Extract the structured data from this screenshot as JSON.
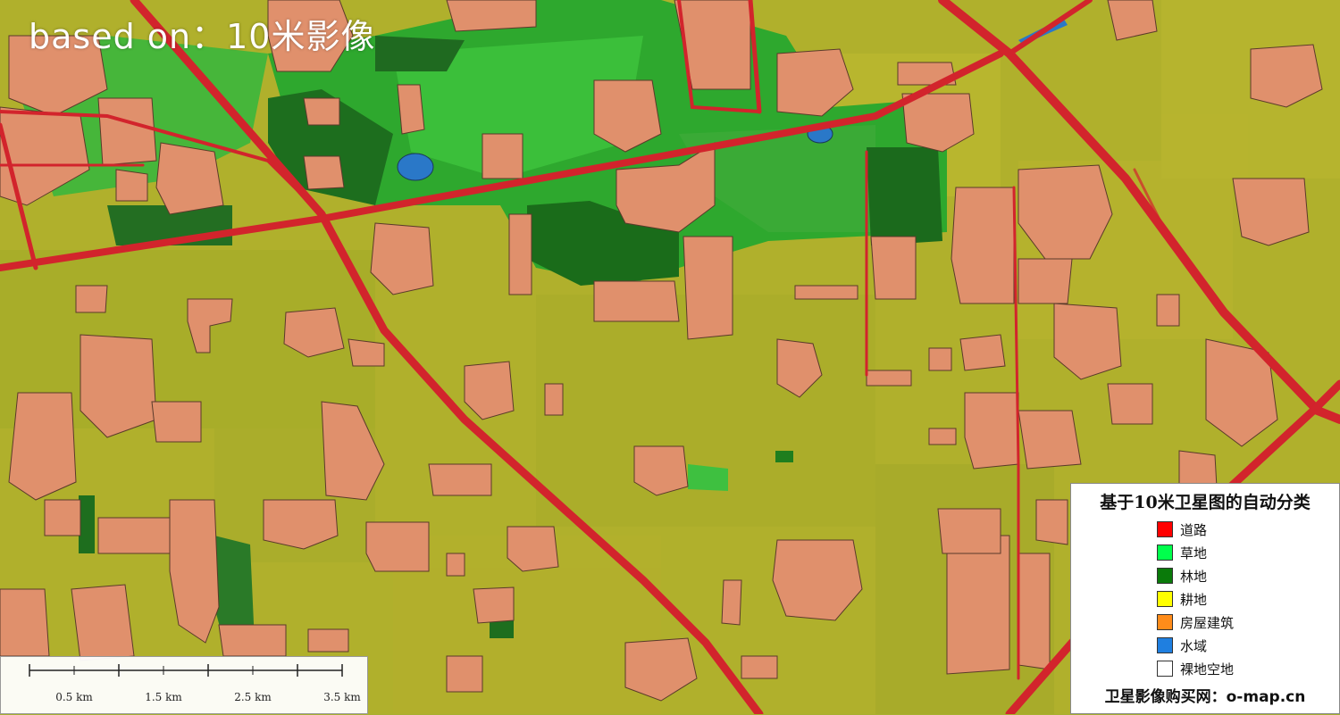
{
  "map": {
    "overlay_title": "based on：10米影像",
    "background_colors": {
      "cropland": "#b4b22a",
      "road": "#d2242c",
      "grass": "#3db530",
      "forest": "#1f7a22",
      "building": "#e1916a",
      "water": "#2a78c8"
    }
  },
  "legend": {
    "title": "基于10米卫星图的自动分类",
    "items": [
      {
        "label": "道路",
        "color": "#ff0000"
      },
      {
        "label": "草地",
        "color": "#00ff4c"
      },
      {
        "label": "林地",
        "color": "#0a7a0a"
      },
      {
        "label": "耕地",
        "color": "#ffff00"
      },
      {
        "label": "房屋建筑",
        "color": "#ff8c1a"
      },
      {
        "label": "水域",
        "color": "#1f7fe0"
      },
      {
        "label": "裸地空地",
        "color": "#ffffff"
      }
    ],
    "footer": "卫星影像购买网：o-map.cn"
  },
  "scalebar": {
    "labels": [
      "0.5 km",
      "1.5 km",
      "2.5 km",
      "3.5 km"
    ]
  }
}
